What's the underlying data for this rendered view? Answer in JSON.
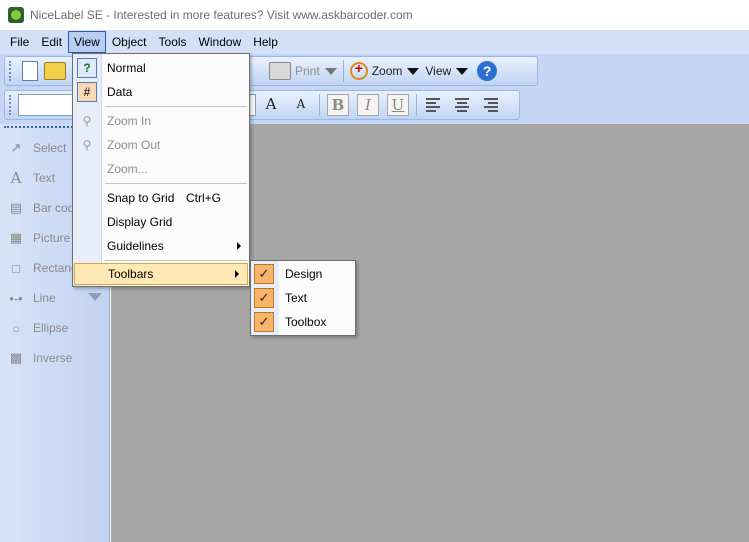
{
  "window": {
    "title": "NiceLabel SE - Interested in more features? Visit www.askbarcoder.com"
  },
  "menubar": [
    {
      "label": "File"
    },
    {
      "label": "Edit"
    },
    {
      "label": "View"
    },
    {
      "label": "Object"
    },
    {
      "label": "Tools"
    },
    {
      "label": "Window"
    },
    {
      "label": "Help"
    }
  ],
  "design_toolbar": {
    "print_label": "Print",
    "zoom_label": "Zoom",
    "view_label": "View",
    "help_glyph": "?"
  },
  "text_toolbar": {
    "font_value": "",
    "grow_font_glyph": "A",
    "shrink_font_glyph": "A",
    "bold_glyph": "B",
    "italic_glyph": "I",
    "underline_glyph": "U"
  },
  "toolbox": {
    "items": [
      {
        "label": "Select",
        "icon": "pointer-icon"
      },
      {
        "label": "Text",
        "icon": "text-a-icon"
      },
      {
        "label": "Bar cod",
        "icon": "barcode-icon"
      },
      {
        "label": "Picture",
        "icon": "picture-icon"
      },
      {
        "label": "Rectang",
        "icon": "rectangle-icon"
      },
      {
        "label": "Line",
        "icon": "line-icon"
      },
      {
        "label": "Ellipse",
        "icon": "ellipse-icon"
      },
      {
        "label": "Inverse",
        "icon": "inverse-icon"
      }
    ]
  },
  "view_menu": {
    "items": [
      {
        "label": "Normal",
        "icon": "normal-view-icon",
        "enabled": true
      },
      {
        "label": "Data",
        "icon": "data-view-icon",
        "enabled": true
      },
      {
        "label": "Zoom In",
        "icon": "zoom-in-icon",
        "enabled": false
      },
      {
        "label": "Zoom Out",
        "icon": "zoom-out-icon",
        "enabled": false
      },
      {
        "label": "Zoom...",
        "enabled": false
      },
      {
        "label": "Snap to Grid",
        "shortcut": "Ctrl+G",
        "enabled": true
      },
      {
        "label": "Display Grid",
        "enabled": true
      },
      {
        "label": "Guidelines",
        "submenu": true,
        "enabled": true
      },
      {
        "label": "Toolbars",
        "submenu": true,
        "enabled": true,
        "highlighted": true
      }
    ]
  },
  "toolbars_submenu": {
    "items": [
      {
        "label": "Design",
        "checked": true
      },
      {
        "label": "Text",
        "checked": true
      },
      {
        "label": "Toolbox",
        "checked": true
      }
    ]
  },
  "colors": {
    "menubar": "#d4e0f6",
    "workspace": "#a6a6a6",
    "highlight": "#ffe8b3",
    "check": "#f9b467"
  }
}
